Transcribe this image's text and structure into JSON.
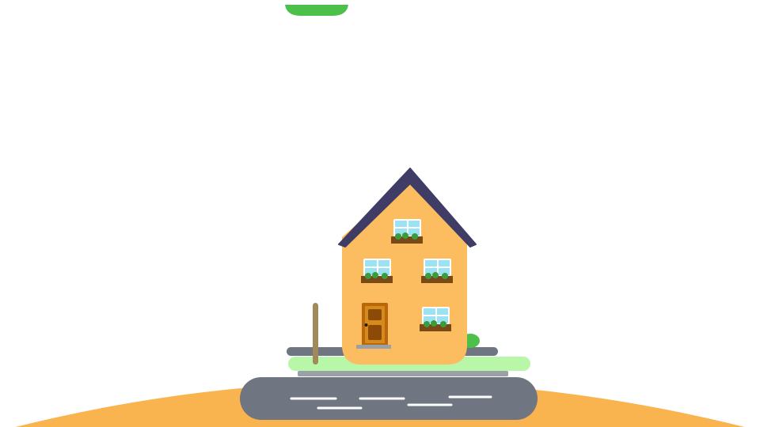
{
  "scene": {
    "colors": {
      "background": "#ffffff",
      "top_pill": "#4cc04a",
      "ground": "#f9b34f",
      "road": "#6f7581",
      "road_marking": "#ffffff",
      "sidewalk": "#6f7581",
      "curb": "#8e949e",
      "lawn": "#b9f7a8",
      "house_wall": "#fbbd5f",
      "roof": "#3f3c66",
      "window_glass": "#9be3f2",
      "window_frame": "#ffffff",
      "planter_box": "#7a4a16",
      "planter_leaves": "#3a9c3d",
      "door": "#b9670d",
      "door_panel": "#8b4a06",
      "door_knob": "#2a1a05",
      "step": "#9aa0a8",
      "post": "#a08a5a",
      "bush": "#4cc04a"
    }
  }
}
